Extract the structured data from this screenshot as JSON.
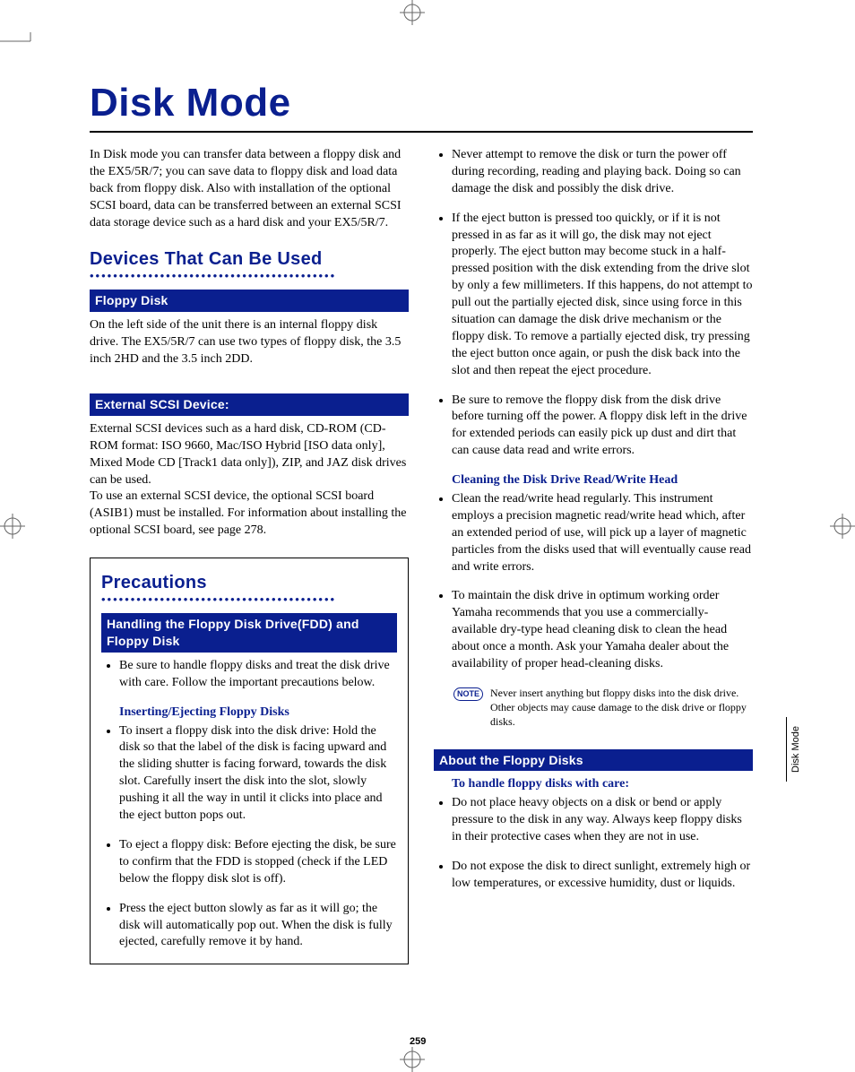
{
  "page": {
    "title": "Disk Mode",
    "intro": "In Disk mode you can transfer data between a floppy disk and the EX5/5R/7; you can save data to floppy disk and load data back from floppy disk. Also with installation of the optional SCSI board, data can be transferred between an external SCSI data storage device such as a hard disk and your EX5/5R/7.",
    "page_number": "259",
    "side_tab": "Disk Mode"
  },
  "sections": {
    "devices": {
      "heading": "Devices That Can Be Used",
      "floppy": {
        "heading": "Floppy Disk",
        "body": "On the left side of the unit there is an internal floppy disk drive. The EX5/5R/7 can use two types of floppy disk, the 3.5 inch 2HD and the 3.5 inch 2DD."
      },
      "scsi": {
        "heading": "External SCSI Device:",
        "body1": "External SCSI devices such as a hard disk, CD-ROM (CD-ROM format: ISO 9660, Mac/ISO Hybrid [ISO data only], Mixed Mode CD [Track1 data only]), ZIP, and JAZ disk drives can be used.",
        "body2": "To use an external SCSI device, the optional SCSI board (ASIB1) must be installed. For information about installing the optional SCSI board, see page 278."
      }
    },
    "precautions": {
      "heading": "Precautions",
      "handling": {
        "heading": "Handling the Floppy Disk Drive(FDD) and Floppy Disk",
        "bullets": [
          "Be sure to handle floppy disks and treat the disk drive with care. Follow the important precautions below."
        ],
        "sub1_heading": "Inserting/Ejecting Floppy Disks",
        "sub1_bullets": [
          "To insert a floppy disk into the disk drive: Hold the disk so that the label of the disk is facing upward and the sliding shutter is facing forward, towards the disk slot. Carefully insert the disk into the slot, slowly pushing it all the way in until it clicks into place and the eject button pops out.",
          "To eject a floppy disk: Before ejecting the disk, be sure to confirm that the FDD is stopped (check if the LED below the floppy disk slot is off).",
          "Press the eject button slowly as far as it will go; the disk will automatically pop out. When the disk is fully ejected, carefully remove it by hand.",
          "Never attempt to remove the disk or turn the power off during recording, reading and playing back. Doing so can damage the disk and possibly the disk drive.",
          "If the eject button is pressed too quickly, or if it is not pressed in as far as it will go, the disk may not eject properly. The eject button may become stuck in a half-pressed position with the disk extending from the drive slot by only a few millimeters. If this happens, do not attempt to pull out the partially ejected disk, since using force in this situation can damage the disk drive mechanism or the floppy disk. To remove a partially ejected disk, try pressing the eject button once again, or push the disk back into the slot and then repeat the eject procedure.",
          "Be sure to remove the floppy disk from the disk drive before turning off the power. A floppy disk left in the drive for extended periods can easily pick up dust and dirt that can cause data read and write errors."
        ],
        "sub2_heading": "Cleaning the Disk Drive Read/Write Head",
        "sub2_bullets": [
          "Clean the read/write head regularly. This instrument employs a precision magnetic read/write head which, after an extended period of use, will pick up a layer of magnetic particles from the disks used that will eventually cause read and write errors.",
          "To maintain the disk drive in optimum working order Yamaha recommends that you use a commercially-available dry-type head cleaning disk to clean the head about once a month. Ask your Yamaha dealer about the availability of proper head-cleaning disks."
        ],
        "note_label": "NOTE",
        "note_text": "Never insert anything but floppy disks into the disk drive. Other objects may cause damage to the disk drive or floppy disks."
      },
      "about": {
        "heading": "About the Floppy Disks",
        "sub_heading": "To handle floppy disks with care:",
        "bullets": [
          "Do not place heavy objects on a disk or bend or apply pressure to the disk in any way. Always keep floppy disks in their protective cases when they are not in use.",
          "Do not expose the disk to direct sunlight, extremely high or low temperatures, or excessive humidity, dust or liquids."
        ]
      }
    }
  }
}
